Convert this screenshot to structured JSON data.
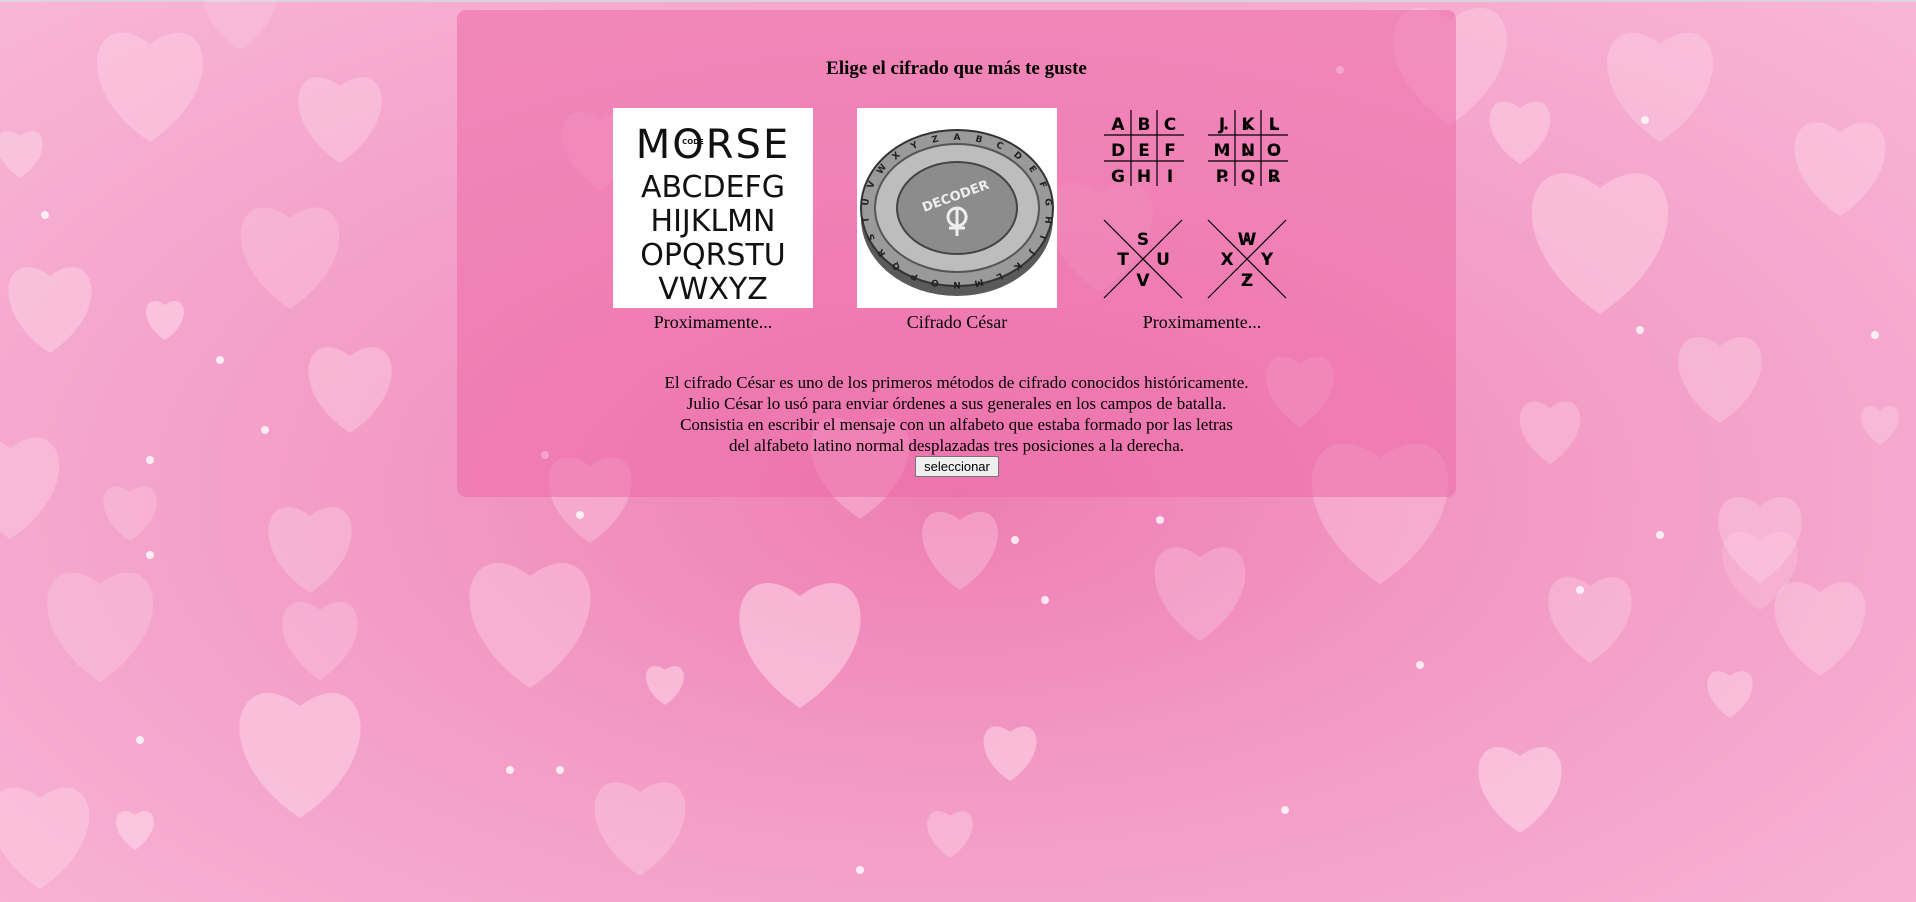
{
  "page": {
    "title": "Elige el cifrado que más te guste"
  },
  "ciphers": [
    {
      "image_text": {
        "word": "MORSE",
        "badge": "CODE",
        "rows": [
          "ABCDEFG",
          "HIJKLMN",
          "OPQRSTU",
          "VWXYZ"
        ]
      },
      "label": "Proximamente..."
    },
    {
      "image_text": {
        "ring": "ABCDEFGHIJKLMNOPQRSTUVWXYZ",
        "center": "DECODER"
      },
      "label": "Cifrado César"
    },
    {
      "image_text": {
        "grid1": [
          "A",
          "B",
          "C",
          "D",
          "E",
          "F",
          "G",
          "H",
          "I"
        ],
        "grid2": [
          "J",
          "K",
          "L",
          "M",
          "N",
          "O",
          "P",
          "Q",
          "R"
        ],
        "x1": [
          "S",
          "T",
          "U",
          "V"
        ],
        "x2": [
          "W",
          "X",
          "Y",
          "Z"
        ]
      },
      "label": "Proximamente..."
    }
  ],
  "description": {
    "lines": [
      "El cifrado César es uno de los primeros métodos de cifrado conocidos históricamente.",
      "Julio César lo usó para enviar órdenes a sus generales en los campos de batalla.",
      "Consistia en escribir el mensaje con un alfabeto que estaba formado por las letras",
      "del alfabeto latino normal desplazadas tres posiciones a la derecha."
    ]
  },
  "select_button": {
    "label": "seleccionar"
  },
  "colors": {
    "background": "#f39cc6",
    "panel": "#ec6aa8",
    "heart": "#ffe0ee"
  },
  "icons": {
    "background": "hearts-pattern",
    "morse": "morse-code-image",
    "caesar": "caesar-decoder-coin-image",
    "pigpen": "pigpen-cipher-image"
  }
}
